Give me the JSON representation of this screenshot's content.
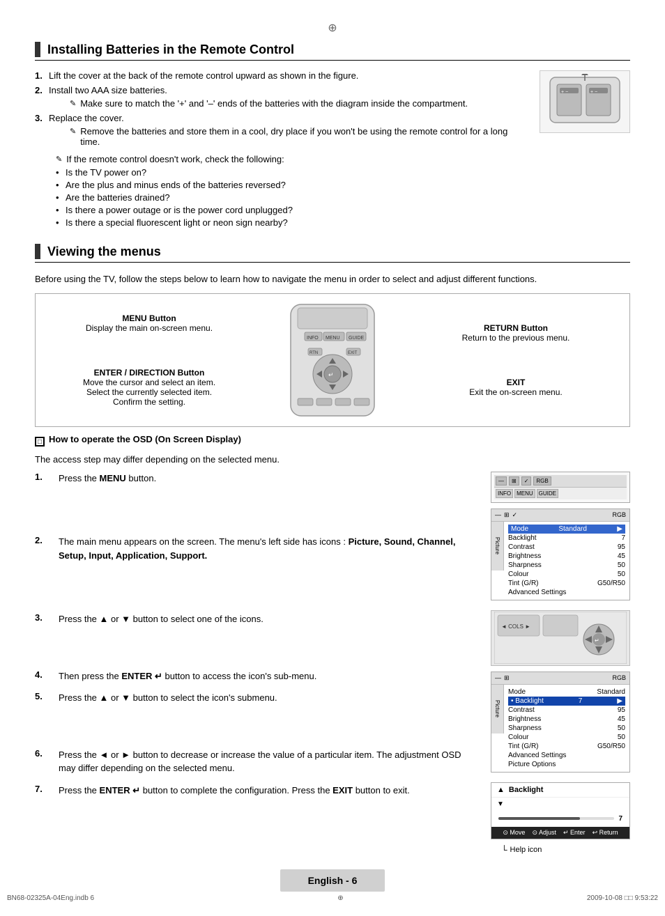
{
  "page": {
    "title": "Installing Batteries in the Remote Control",
    "section2_title": "Viewing the menus",
    "footer_lang": "English - 6",
    "footer_file": "BN68-02325A-04Eng.indb   6",
    "footer_date": "2009-10-08   □□ 9:53:22"
  },
  "battery": {
    "step1": "Lift the cover at the back of the remote control upward as shown in the figure.",
    "step2": "Install two AAA size batteries.",
    "step2_note": "Make sure to match the '+' and '–' ends of the batteries with the diagram inside the compartment.",
    "step3": "Replace the cover.",
    "step3_note": "Remove the batteries and store them in a cool, dry place if you won't be using the remote control for a long time.",
    "note_main": "If the remote control doesn't work, check the following:",
    "bullet1": "Is the TV power on?",
    "bullet2": "Are the plus and minus ends of the batteries reversed?",
    "bullet3": "Are the batteries drained?",
    "bullet4": "Is there a power outage or is the power cord unplugged?",
    "bullet5": "Is there a special fluorescent light or neon sign nearby?"
  },
  "viewing_menus": {
    "intro": "Before using the TV, follow the steps below to learn how to navigate the menu in order to select and adjust different functions.",
    "menu_button_label": "MENU Button",
    "menu_button_desc": "Display the main on-screen menu.",
    "enter_button_label": "ENTER  / DIRECTION Button",
    "enter_button_desc1": "Move the cursor and select an item.",
    "enter_button_desc2": "Select the currently selected item.",
    "enter_button_desc3": "Confirm the setting.",
    "return_button_label": "RETURN Button",
    "return_button_desc": "Return to the previous menu.",
    "exit_label": "EXIT",
    "exit_desc": "Exit the on-screen menu."
  },
  "osd": {
    "header": "How to operate the OSD (On Screen Display)",
    "access_note": "The access step may differ depending on the selected menu.",
    "step1_num": "1.",
    "step1_text": "Press the MENU button.",
    "step2_num": "2.",
    "step2_text": "The main menu appears on the screen. The menu's left side has icons : Picture, Sound, Channel, Setup, Input, Application, Support.",
    "step3_num": "3.",
    "step3_text": "Press the ▲ or ▼ button to select one of the icons.",
    "step4_num": "4.",
    "step4_text": "Then press the ENTER  button to access the icon's sub-menu.",
    "step5_num": "5.",
    "step5_text": "Press the ▲ or ▼ button to select the icon's submenu.",
    "step6_num": "6.",
    "step6_text": "Press the ◄ or ► button to decrease or increase the value of a particular item. The adjustment OSD may differ depending on the selected menu.",
    "step7_num": "7.",
    "step7_text": "Press the ENTER  button to complete the configuration. Press the EXIT button to exit.",
    "help_icon_label": "Help icon",
    "tv_menu": {
      "mode_label": "Mode",
      "mode_value": "Standard",
      "backlight_label": "Backlight",
      "backlight_value": "7",
      "contrast_label": "Contrast",
      "contrast_value": "95",
      "brightness_label": "Brightness",
      "brightness_value": "45",
      "sharpness_label": "Sharpness",
      "sharpness_value": "50",
      "colour_label": "Colour",
      "colour_value": "50",
      "tint_label": "Tint (G/R)",
      "tint_value": "G50/R50",
      "advanced_label": "Advanced Settings",
      "side_icon": "Picture"
    },
    "tv_menu2": {
      "mode_label": "Mode",
      "mode_value": "Standard",
      "backlight_label": "• Backlight",
      "backlight_value": "7",
      "contrast_label": "Contrast",
      "contrast_value": "95",
      "brightness_label": "Brightness",
      "brightness_value": "45",
      "sharpness_label": "Sharpness",
      "sharpness_value": "50",
      "colour_label": "Colour",
      "colour_value": "50",
      "tint_label": "Tint (G/R)",
      "tint_value": "G50/R50",
      "advanced_label": "Advanced Settings",
      "options_label": "Picture Options",
      "side_icon": "Picture"
    },
    "backlight_screen": {
      "up_arrow": "▲",
      "label": "Backlight",
      "down_arrow": "▼",
      "value": "7",
      "nav_move": "Move",
      "nav_adjust": "Adjust",
      "nav_enter": "Enter",
      "nav_return": "Return"
    }
  }
}
